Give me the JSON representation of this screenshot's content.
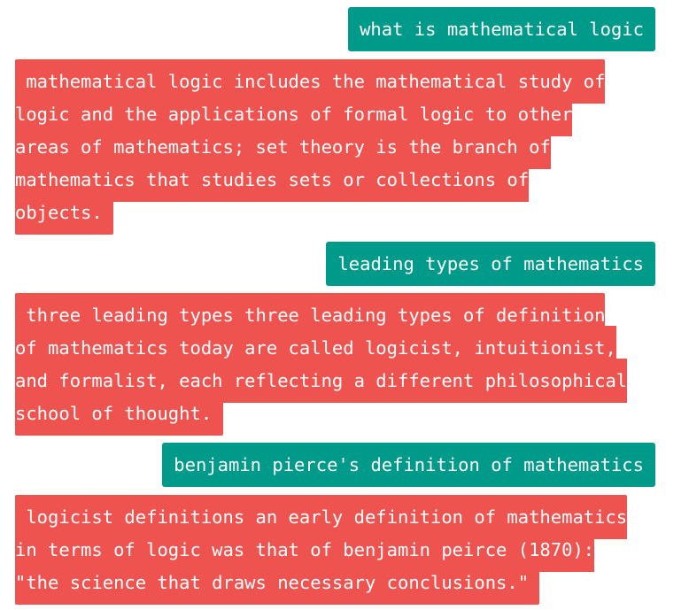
{
  "conversation": [
    {
      "role": "user",
      "text": "what is mathematical logic"
    },
    {
      "role": "bot",
      "lines": [
        " mathematical logic includes the mathematical study of",
        "logic and the applications of formal logic to other",
        "areas of mathematics; set theory is the branch of",
        "mathematics that studies sets or collections of",
        "objects. "
      ]
    },
    {
      "role": "user",
      "text": "leading types of mathematics"
    },
    {
      "role": "bot",
      "lines": [
        " three leading types three leading types of definition",
        "of mathematics today are called logicist, intuitionist,",
        "and formalist, each reflecting a different philosophical",
        "school of thought. "
      ]
    },
    {
      "role": "user",
      "text": "benjamin pierce's definition of mathematics"
    },
    {
      "role": "bot",
      "lines": [
        " logicist definitions an early definition of mathematics",
        "in terms of logic was that of benjamin peirce (1870):",
        "\"the science that draws necessary conclusions.\" "
      ]
    }
  ],
  "colors": {
    "user_bubble": "#009a8a",
    "bot_bubble": "#ef5350",
    "text": "#ffffff",
    "background": "#ffffff"
  }
}
